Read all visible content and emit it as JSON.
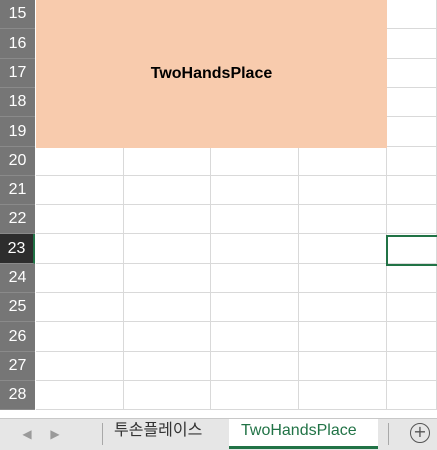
{
  "rows": [
    "15",
    "16",
    "17",
    "18",
    "19",
    "20",
    "21",
    "22",
    "23",
    "24",
    "25",
    "26",
    "27",
    "28"
  ],
  "active_row": "23",
  "merged_cell": {
    "text": "TwoHandsPlace",
    "fill_color": "#f8cbad"
  },
  "tabs": [
    {
      "label": "투손플레이스",
      "active": false
    },
    {
      "label": "TwoHandsPlace",
      "active": true
    }
  ],
  "nav": {
    "prev": "◀",
    "next": "▶"
  },
  "add_sheet_symbol": "+",
  "colors": {
    "accent": "#217346",
    "row_header_bg": "#767676",
    "active_row_header_bg": "#2d2d2d",
    "gridline": "#d9d9d9"
  }
}
